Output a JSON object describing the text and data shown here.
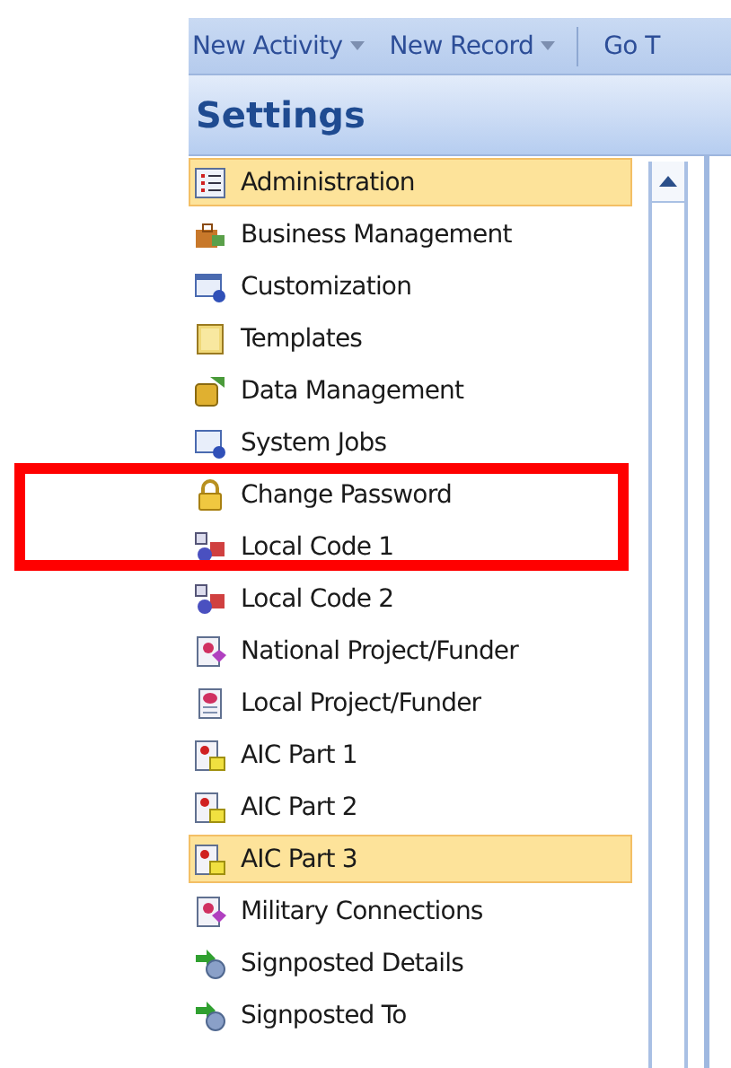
{
  "toolbar": {
    "items": [
      {
        "label": "New Activity",
        "dropdown": true
      },
      {
        "label": "New Record",
        "dropdown": true
      },
      {
        "label": "Go T",
        "dropdown": false
      }
    ]
  },
  "panel": {
    "title": "Settings"
  },
  "items": [
    {
      "label": "Administration",
      "selected": true
    },
    {
      "label": "Business Management",
      "selected": false
    },
    {
      "label": "Customization",
      "selected": false
    },
    {
      "label": "Templates",
      "selected": false
    },
    {
      "label": "Data Management",
      "selected": false
    },
    {
      "label": "System Jobs",
      "selected": false
    },
    {
      "label": "Change Password",
      "selected": false
    },
    {
      "label": "Local Code 1",
      "selected": false
    },
    {
      "label": "Local Code 2",
      "selected": false
    },
    {
      "label": "National Project/Funder",
      "selected": false
    },
    {
      "label": "Local Project/Funder",
      "selected": false
    },
    {
      "label": "AIC Part 1",
      "selected": false
    },
    {
      "label": "AIC Part 2",
      "selected": false
    },
    {
      "label": "AIC Part 3",
      "selected": true
    },
    {
      "label": "Military Connections",
      "selected": false
    },
    {
      "label": "Signposted Details",
      "selected": false
    },
    {
      "label": "Signposted To",
      "selected": false
    }
  ]
}
